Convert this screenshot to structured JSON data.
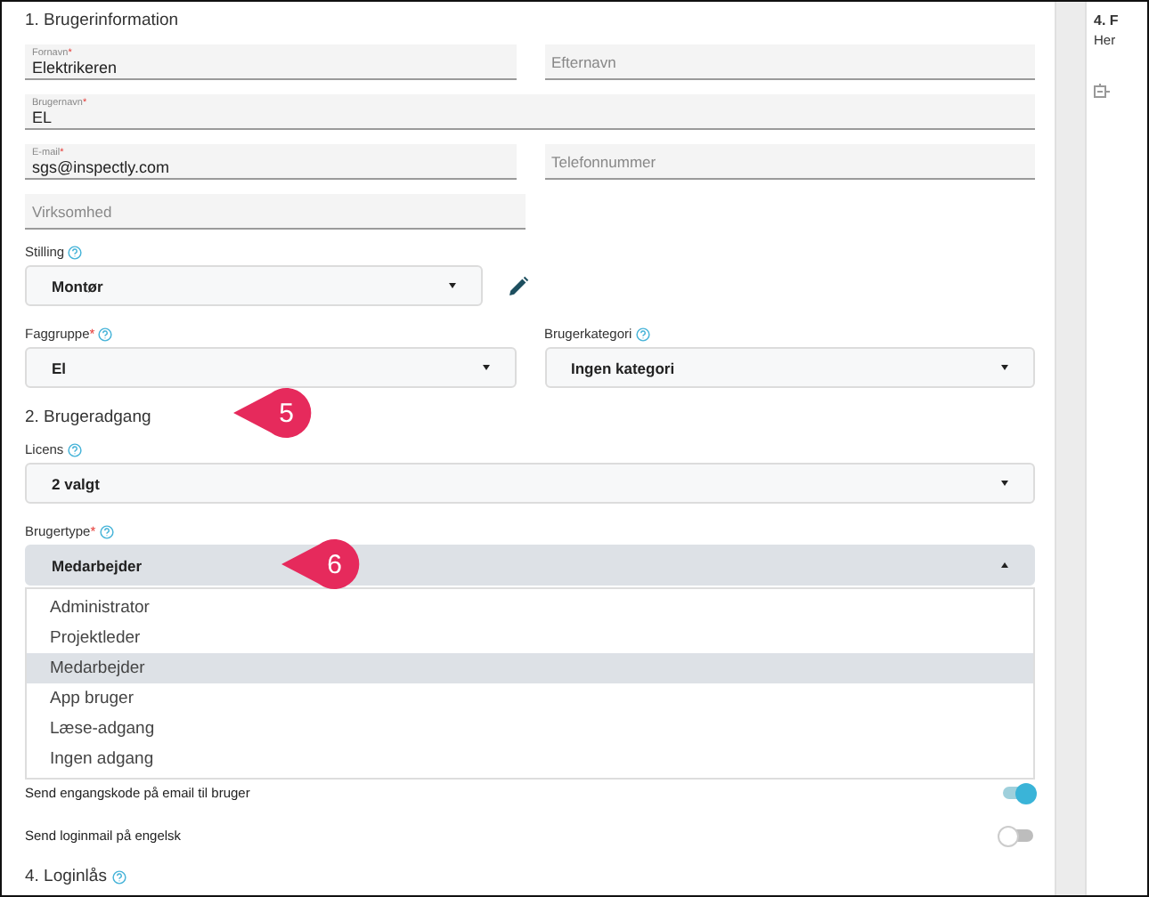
{
  "section1": {
    "title": "1. Brugerinformation"
  },
  "text_rows": [
    [
      {
        "label": "Fornavn",
        "required_mark": "*",
        "value": "Elektrikeren"
      },
      {
        "placeholder": "Efternavn"
      }
    ],
    [
      {
        "label": "Brugernavn",
        "required_mark": "*",
        "value": "EL"
      }
    ],
    [
      {
        "label": "E-mail",
        "required_mark": "*",
        "value": "sgs@inspectly.com"
      },
      {
        "placeholder": "Telefonnummer"
      }
    ],
    [
      {
        "placeholder": "Virksomhed"
      }
    ]
  ],
  "stilling": {
    "label": "Stilling",
    "help": true,
    "value": "Montør",
    "editable": true
  },
  "faggruppe": {
    "label": "Faggruppe",
    "required_mark": "*",
    "help": true,
    "value": "El"
  },
  "brugerkategori": {
    "label": "Brugerkategori",
    "help": true,
    "value": "Ingen kategori"
  },
  "section2": {
    "title": "2. Brugeradgang",
    "callout": "5"
  },
  "licens": {
    "label": "Licens",
    "help": true,
    "value": "2 valgt"
  },
  "brugertype": {
    "label": "Brugertype",
    "required_mark": "*",
    "help": true,
    "value": "Medarbejder",
    "expanded": true,
    "callout": "6",
    "options": [
      {
        "label": "Administrator",
        "selected": false
      },
      {
        "label": "Projektleder",
        "selected": false
      },
      {
        "label": "Medarbejder",
        "selected": true
      },
      {
        "label": "App bruger",
        "selected": false
      },
      {
        "label": "Læse-adgang",
        "selected": false
      },
      {
        "label": "Ingen adgang",
        "selected": false
      }
    ]
  },
  "toggles": [
    {
      "label": "Send engangskode på email til bruger",
      "on": true
    },
    {
      "label": "Send loginmail på engelsk",
      "on": false
    }
  ],
  "section4": {
    "title": "4. Loginlås",
    "help": true
  },
  "side_panel": {
    "title": "4. F",
    "text": "Her"
  }
}
